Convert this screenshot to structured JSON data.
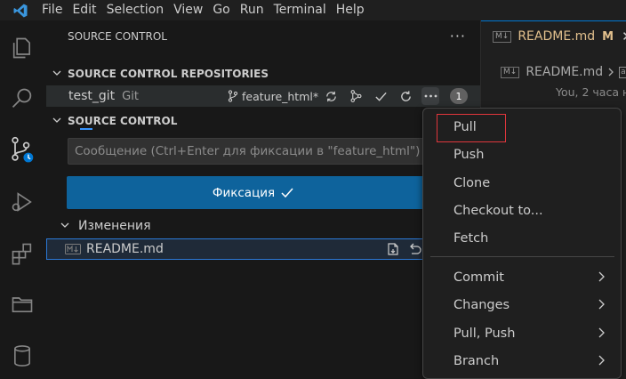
{
  "menubar": {
    "items": [
      "File",
      "Edit",
      "Selection",
      "View",
      "Go",
      "Run",
      "Terminal",
      "Help"
    ]
  },
  "sidebar": {
    "header": "SOURCE CONTROL",
    "repositories_title": "SOURCE CONTROL REPOSITORIES",
    "repo": {
      "name": "test_git",
      "kind": "Git",
      "branch": "feature_html*",
      "badge": "1"
    },
    "scm_title": "SOURCE CONTROL",
    "commit_placeholder": "Сообщение (Ctrl+Enter для фиксации в \"feature_html\")",
    "commit_button": "Фиксация",
    "changes_label": "Изменения",
    "file_name": "README.md"
  },
  "editor": {
    "tab_label": "README.md",
    "tab_modified": "M",
    "breadcrumb": "README.md",
    "blame": "You, 2 часа н"
  },
  "context_menu": {
    "items": [
      "Pull",
      "Push",
      "Clone",
      "Checkout to...",
      "Fetch"
    ],
    "submenus": [
      "Commit",
      "Changes",
      "Pull, Push",
      "Branch"
    ]
  },
  "colors": {
    "accent": "#0e639c",
    "highlight_outline": "#e0363c",
    "modified": "#e2c08d"
  }
}
